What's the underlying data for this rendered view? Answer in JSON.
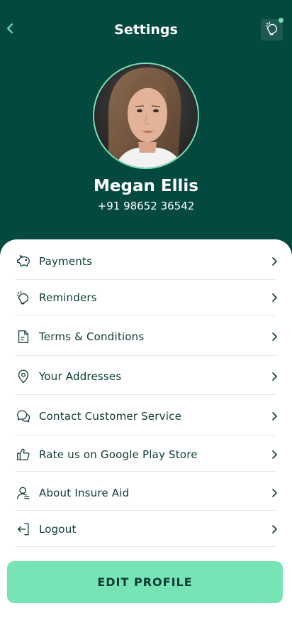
{
  "header": {
    "title": "Settings",
    "back_icon": "chevron-left-icon",
    "reminder_icon": "reminder-bell-icon"
  },
  "profile": {
    "name": "Megan Ellis",
    "phone": "+91 98652 36542"
  },
  "menu": [
    {
      "label": "Payments",
      "icon": "piggy-bank-icon"
    },
    {
      "label": "Reminders",
      "icon": "reminder-bell-icon"
    },
    {
      "label": "Terms & Conditions",
      "icon": "document-icon"
    },
    {
      "label": "Your Addresses",
      "icon": "location-pin-icon"
    },
    {
      "label": "Contact Customer Service",
      "icon": "chat-bubbles-icon"
    },
    {
      "label": "Rate us on Google Play Store",
      "icon": "thumbs-up-icon"
    },
    {
      "label": "About Insure Aid",
      "icon": "user-info-icon"
    },
    {
      "label": "Logout",
      "icon": "logout-icon"
    }
  ],
  "edit_profile_label": "EDIT PROFILE",
  "colors": {
    "header_bg": "#034940",
    "accent": "#77e4b5",
    "text_dark": "#0c3b36",
    "notification_dot": "#6fe3b1"
  }
}
